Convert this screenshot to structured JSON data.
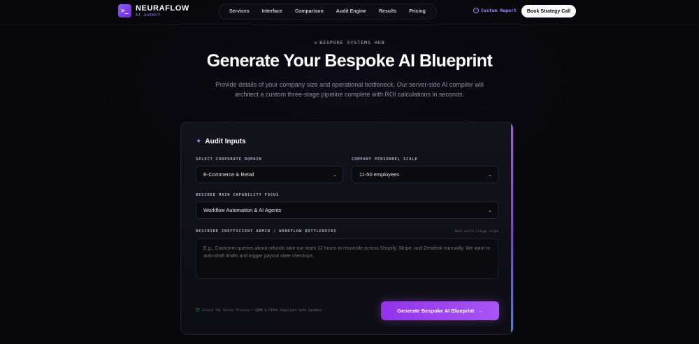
{
  "brand": {
    "name": "NEURAFLOW",
    "sub": "AI AGENCY",
    "mark": ">_"
  },
  "nav": [
    "Services",
    "Interface",
    "Comparison",
    "Audit Engine",
    "Results",
    "Pricing"
  ],
  "header": {
    "custom_report": "Custom Report",
    "cta": "Book Strategy Call"
  },
  "hero": {
    "eyebrow": "BESPOKE SYSTEMS HUB",
    "title": "Generate Your Bespoke AI Blueprint",
    "description": "Provide details of your company size and operational bottleneck. Our server-side AI compiler will architect a custom three-stage pipeline complete with ROI calculations in seconds."
  },
  "form": {
    "title": "Audit Inputs",
    "domain": {
      "label": "SELECT CORPORATE DOMAIN",
      "value": "E-Commerce & Retail"
    },
    "scale": {
      "label": "COMPANY PERSONNEL SCALE",
      "value": "11-50 employees"
    },
    "focus": {
      "label": "DESIRED MAIN CAPABILITY FOCUS",
      "value": "Workflow Automation & AI Agents"
    },
    "bottleneck": {
      "label": "DESCRIBE INEFFICIENT ADMIN / WORKFLOW BOTTLENECKS",
      "hint": "Real-world triage scope",
      "placeholder": "E.g., Customer queries about refunds take our team 12 hours to reconcile across Shopify, Stripe, and Zendesk manually. We want to auto-draft drafts and trigger payout state checkups."
    },
    "secure_note": "Secure SSL Server Process • GDPR & HIPAA Compliant Safe Sandbox",
    "submit": "Generate Bespoke AI Blueprint"
  },
  "colors": {
    "accent": "#a855f7",
    "bg": "#07070b",
    "card": "#12121a"
  }
}
